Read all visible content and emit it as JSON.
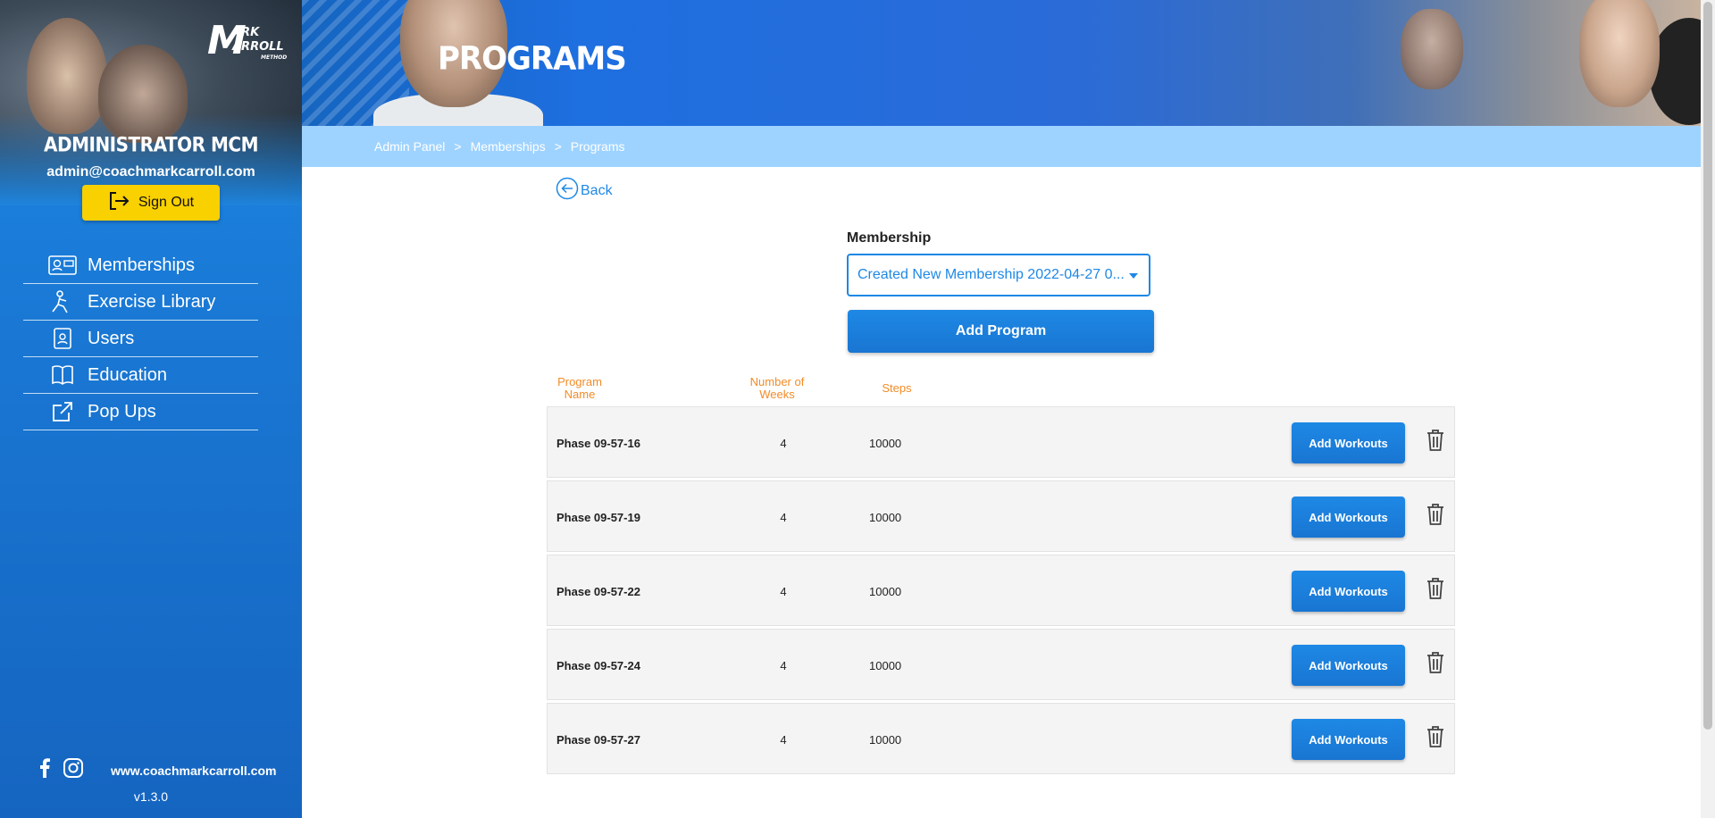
{
  "app": {
    "logo_text": [
      "M",
      "ARK",
      "ARROLL",
      "METHOD"
    ]
  },
  "sidebar": {
    "admin_name": "ADMINISTRATOR MCM",
    "admin_email": "admin@coachmarkcarroll.com",
    "signout_label": "Sign Out",
    "items": [
      {
        "label": "Memberships",
        "icon": "membership-card-icon"
      },
      {
        "label": "Exercise Library",
        "icon": "exercise-person-icon"
      },
      {
        "label": "Users",
        "icon": "user-badge-icon"
      },
      {
        "label": "Education",
        "icon": "book-icon"
      },
      {
        "label": "Pop Ups",
        "icon": "external-link-icon"
      }
    ],
    "website": "www.coachmarkcarroll.com",
    "version": "v1.3.0"
  },
  "header": {
    "title": "PROGRAMS"
  },
  "breadcrumb": [
    "Admin Panel",
    ">",
    "Memberships",
    ">",
    "Programs"
  ],
  "main": {
    "back_label": "Back",
    "membership_label": "Membership",
    "membership_value": "Created New Membership 2022-04-27 0...",
    "add_program_label": "Add Program",
    "columns": [
      {
        "line1": "Program",
        "line2": "Name"
      },
      {
        "line1": "Number of",
        "line2": "Weeks"
      },
      {
        "line1": "Steps",
        "line2": ""
      }
    ],
    "action_label": "Add Workouts",
    "rows": [
      {
        "name": "Phase 09-57-16",
        "weeks": "4",
        "steps": "10000"
      },
      {
        "name": "Phase 09-57-19",
        "weeks": "4",
        "steps": "10000"
      },
      {
        "name": "Phase 09-57-22",
        "weeks": "4",
        "steps": "10000"
      },
      {
        "name": "Phase 09-57-24",
        "weeks": "4",
        "steps": "10000"
      },
      {
        "name": "Phase 09-57-27",
        "weeks": "4",
        "steps": "10000"
      }
    ]
  },
  "colors": {
    "primary": "#1e88e5",
    "accent_yellow": "#f9d000",
    "header_orange": "#f28c28",
    "breadcrumb_bg": "#9fd3ff"
  }
}
